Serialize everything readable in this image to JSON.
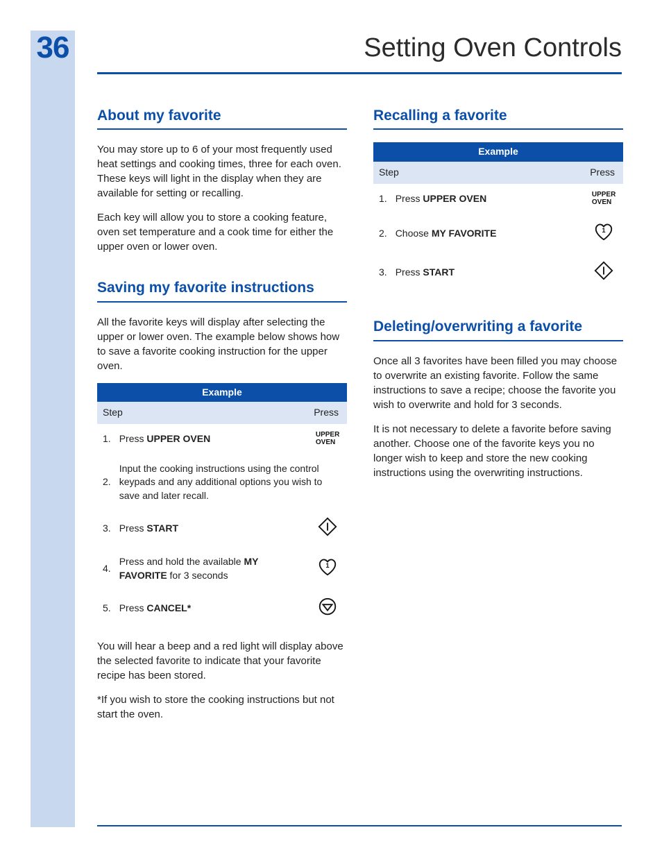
{
  "page_number": "36",
  "page_title": "Setting Oven Controls",
  "left": {
    "about": {
      "heading": "About my favorite",
      "p1": "You may store up to 6 of your most frequently used heat settings and cooking times, three for each oven. These keys will light in the display when they are available for setting or recalling.",
      "p2": "Each key will allow you to store a cooking feature, oven set temperature and a cook time for either the upper oven or lower oven."
    },
    "saving": {
      "heading": "Saving my favorite instructions",
      "intro": "All the favorite keys will display after selecting the upper or lower oven. The example below shows how to save a favorite cooking instruction for the upper oven.",
      "table_title": "Example",
      "col_step": "Step",
      "col_press": "Press",
      "rows": {
        "r1_num": "1.",
        "r1_a": "Press ",
        "r1_b": "UPPER OVEN",
        "r2_num": "2.",
        "r2": "Input the cooking instructions using the control keypads and any additional options you wish to save and later recall.",
        "r3_num": "3.",
        "r3_a": "Press ",
        "r3_b": "START",
        "r4_num": "4.",
        "r4_a": "Press and hold the available ",
        "r4_b": "MY FAVORITE",
        "r4_c": " for 3 seconds",
        "r5_num": "5.",
        "r5_a": "Press ",
        "r5_b": "CANCEL*"
      },
      "after1": "You will hear a beep and a red light will display above the selected favorite to indicate that your favorite recipe has been stored.",
      "after2": "*If you wish to store the cooking instructions but not start the oven."
    }
  },
  "right": {
    "recall": {
      "heading": "Recalling a favorite",
      "table_title": "Example",
      "col_step": "Step",
      "col_press": "Press",
      "rows": {
        "r1_num": "1.",
        "r1_a": "Press ",
        "r1_b": "UPPER OVEN",
        "r2_num": "2.",
        "r2_a": "Choose ",
        "r2_b": "MY FAVORITE",
        "r3_num": "3.",
        "r3_a": "Press ",
        "r3_b": "START"
      }
    },
    "delete": {
      "heading": "Deleting/overwriting a favorite",
      "p1": "Once all 3 favorites have been filled you may choose to overwrite an existing favorite. Follow the same instructions to save a recipe; choose the favorite you wish to overwrite and hold for 3 seconds.",
      "p2": "It is not necessary to delete a favorite before saving another. Choose one of the favorite keys you no longer wish to keep and store the new cooking instructions using the overwriting instructions."
    }
  },
  "icon_labels": {
    "upper_oven_line1": "UPPER",
    "upper_oven_line2": "OVEN"
  }
}
